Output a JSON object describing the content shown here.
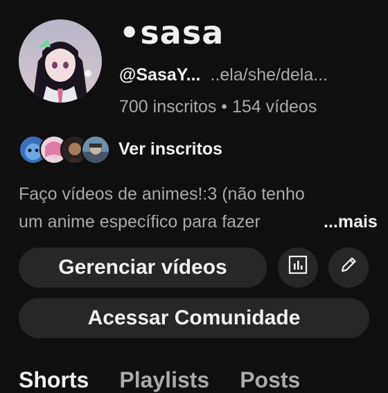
{
  "channel": {
    "name": "•sasa",
    "handle": "@SasaY...",
    "pronouns": "..ela/she/dela...",
    "subscribers": "700 inscritos",
    "separator": " • ",
    "videos": "154 vídeos"
  },
  "subscribers_link": {
    "label": "Ver inscritos"
  },
  "description": {
    "line1": "Faço vídeos de animes!:3 (não tenho",
    "line2": "um anime específico para fazer",
    "more_label": "...mais"
  },
  "buttons": {
    "manage_videos": "Gerenciar vídeos",
    "community": "Acessar Comunidade",
    "stats_icon": "analytics-icon",
    "edit_icon": "pencil-icon"
  },
  "tabs": [
    {
      "label": "Shorts",
      "active": true
    },
    {
      "label": "Playlists",
      "active": false
    },
    {
      "label": "Posts",
      "active": false
    }
  ],
  "colors": {
    "background": "#0f0f0f",
    "button_bg": "#272727",
    "text_primary": "#f1f1f1",
    "text_secondary": "#aaaaaa"
  }
}
